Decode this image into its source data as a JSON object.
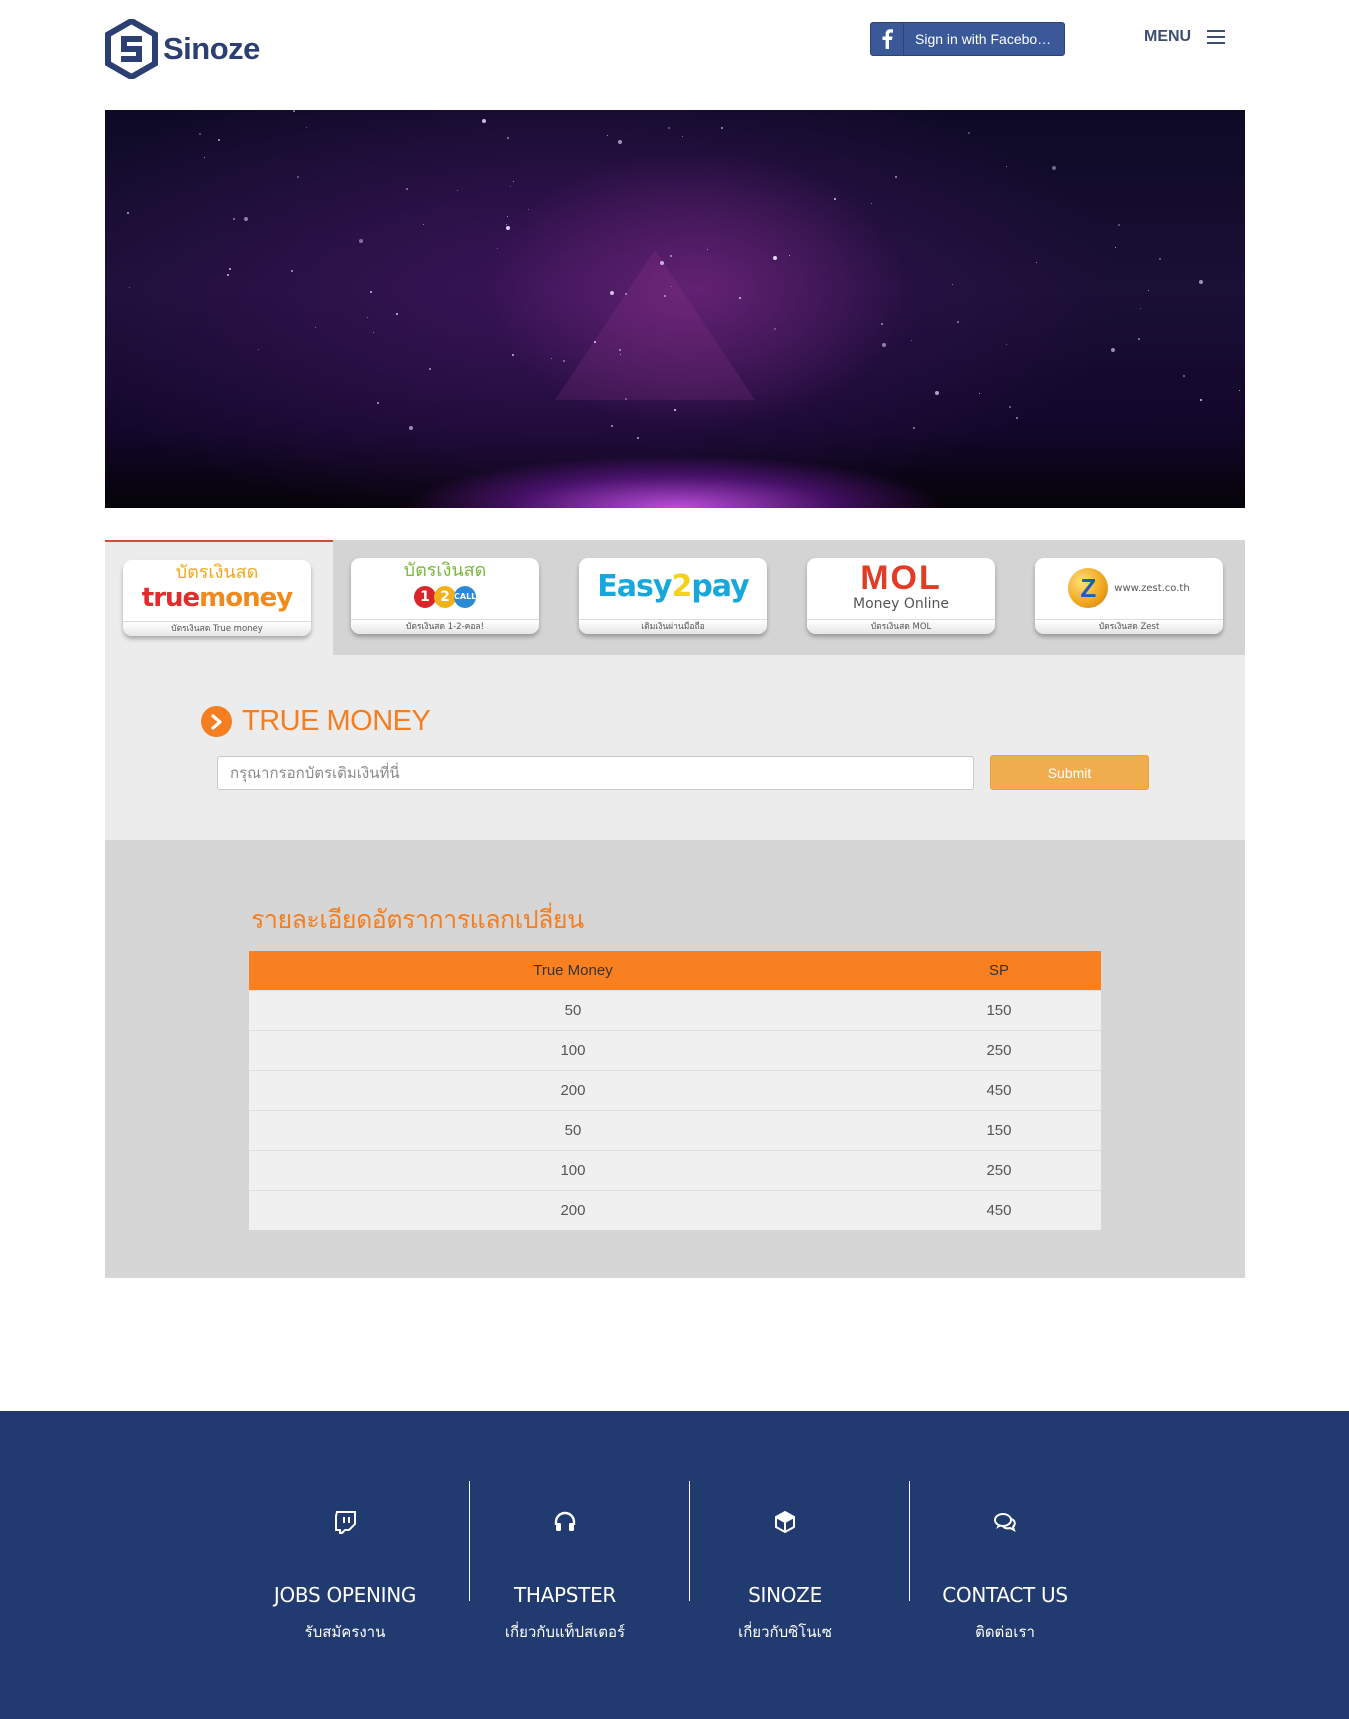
{
  "header": {
    "logo_text": "Sinoze",
    "facebook_label": "Sign in with Facebo…",
    "menu_label": "MENU"
  },
  "payment_tabs": [
    {
      "brand_top": "บัตรเงินสด",
      "brand_main": "truemoney",
      "caption": "บัตรเงินสด True money"
    },
    {
      "brand_top": "บัตรเงินสด",
      "brand_main": "1-2-CALL!",
      "caption": "บัตรเงินสด 1-2-คอล!"
    },
    {
      "brand_top": "",
      "brand_main": "Easy2pay",
      "caption": "เติมเงินผ่านมือถือ"
    },
    {
      "brand_top": "Money Online",
      "brand_main": "MOL",
      "caption": "บัตรเงินสด MOL"
    },
    {
      "brand_top": "www.zest.co.th",
      "brand_main": "Z",
      "caption": "บัตรเงินสด Zest"
    }
  ],
  "form": {
    "title": "TRUE MONEY",
    "input_placeholder": "กรุณากรอกบัตรเติมเงินที่นี่",
    "submit_label": "Submit"
  },
  "rates": {
    "title": "รายละเอียดอัตราการแลกเปลี่ยน",
    "headers": [
      "True Money",
      "SP"
    ],
    "rows": [
      [
        "50",
        "150"
      ],
      [
        "100",
        "250"
      ],
      [
        "200",
        "450"
      ],
      [
        "50",
        "150"
      ],
      [
        "100",
        "250"
      ],
      [
        "200",
        "450"
      ]
    ]
  },
  "footer": {
    "items": [
      {
        "icon": "twitch-icon",
        "title": "JOBS OPENING",
        "subtitle": "รับสมัครงาน"
      },
      {
        "icon": "headphones-icon",
        "title": "THAPSTER",
        "subtitle": "เกี่ยวกับแท็ปสเตอร์"
      },
      {
        "icon": "cube-icon",
        "title": "SINOZE",
        "subtitle": "เกี่ยวกับซิโนเซ"
      },
      {
        "icon": "comments-icon",
        "title": "CONTACT US",
        "subtitle": "ติดต่อเรา"
      }
    ]
  },
  "colors": {
    "brand_navy": "#2c3f73",
    "accent_orange": "#f47e20",
    "facebook_blue": "#3b5998",
    "submit_orange": "#f0ad4e",
    "footer_bg": "#213a6f"
  }
}
